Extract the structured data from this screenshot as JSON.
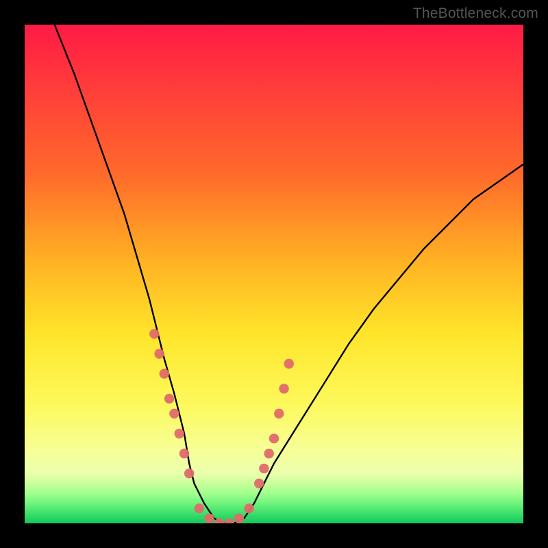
{
  "watermark": "TheBottleneck.com",
  "colors": {
    "bg": "#000000",
    "gradient_top": "#ff1a45",
    "gradient_mid": "#ffe52a",
    "gradient_bottom": "#12c85d",
    "curve": "#000000",
    "dot": "#e06a6a"
  },
  "chart_data": {
    "type": "line",
    "title": "",
    "xlabel": "",
    "ylabel": "",
    "xlim": [
      0,
      100
    ],
    "ylim": [
      0,
      100
    ],
    "series": [
      {
        "name": "bottleneck-curve",
        "x": [
          6,
          10,
          15,
          20,
          25,
          28,
          30,
          32,
          33,
          34,
          36,
          38,
          40,
          42,
          44,
          46,
          48,
          50,
          55,
          60,
          65,
          70,
          80,
          90,
          100
        ],
        "y": [
          100,
          90,
          76,
          62,
          45,
          33,
          26,
          18,
          12,
          8,
          4,
          1,
          0,
          0,
          1,
          4,
          8,
          12,
          20,
          28,
          36,
          43,
          55,
          65,
          72
        ]
      }
    ],
    "points": [
      {
        "name": "left-cluster",
        "x": [
          26,
          27,
          28,
          29,
          30,
          31,
          32,
          33
        ],
        "y": [
          38,
          34,
          30,
          25,
          22,
          18,
          14,
          10
        ]
      },
      {
        "name": "valley-floor",
        "x": [
          35,
          37,
          39,
          41,
          43,
          45
        ],
        "y": [
          3,
          1,
          0,
          0,
          1,
          3
        ]
      },
      {
        "name": "right-cluster",
        "x": [
          47,
          48,
          49,
          50,
          51,
          52,
          53
        ],
        "y": [
          8,
          11,
          14,
          17,
          22,
          27,
          32
        ]
      }
    ]
  }
}
